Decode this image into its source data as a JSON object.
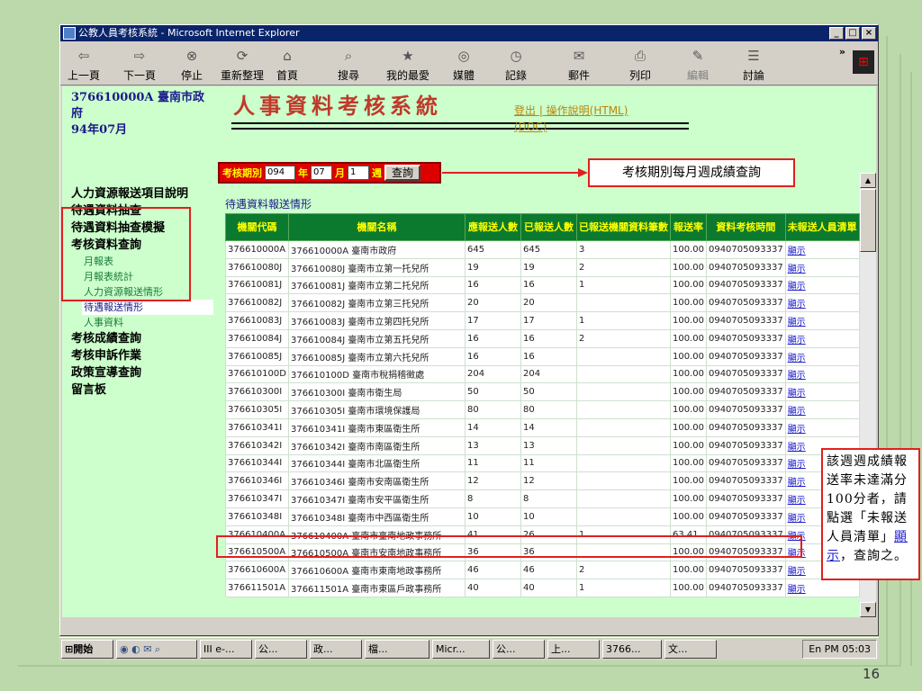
{
  "window": {
    "title": "公教人員考核系統 - Microsoft Internet Explorer",
    "buttons": [
      "_",
      "□",
      "×"
    ]
  },
  "toolbar": {
    "items": [
      {
        "label": "上一頁",
        "icon": "back-arrow-icon",
        "glyph": "⇦"
      },
      {
        "label": "下一頁",
        "icon": "forward-arrow-icon",
        "glyph": "⇨"
      },
      {
        "label": "停止",
        "icon": "stop-icon",
        "glyph": "⊗"
      },
      {
        "label": "重新整理",
        "icon": "refresh-icon",
        "glyph": "⟳"
      },
      {
        "label": "首頁",
        "icon": "home-icon",
        "glyph": "⌂"
      },
      {
        "label": "搜尋",
        "icon": "search-icon",
        "glyph": "⌕"
      },
      {
        "label": "我的最愛",
        "icon": "favorites-icon",
        "glyph": "★"
      },
      {
        "label": "媒體",
        "icon": "media-icon",
        "glyph": "◎"
      },
      {
        "label": "記錄",
        "icon": "history-icon",
        "glyph": "◷"
      },
      {
        "label": "郵件",
        "icon": "mail-icon",
        "glyph": "✉"
      },
      {
        "label": "列印",
        "icon": "print-icon",
        "glyph": "⎙"
      },
      {
        "label": "編輯",
        "icon": "edit-icon",
        "glyph": "✎"
      },
      {
        "label": "討論",
        "icon": "discuss-icon",
        "glyph": "☰"
      }
    ]
  },
  "sidebar": {
    "org_line1": "376610000A 臺南市政府",
    "org_line2": "94年07月",
    "menu": [
      {
        "label": "人力資源報送項目說明",
        "level": 1
      },
      {
        "label": "待遇資料抽查",
        "level": 1
      },
      {
        "label": "待遇資料抽查模擬",
        "level": 1
      },
      {
        "label": "考核資料查詢",
        "level": 1
      },
      {
        "label": "月報表",
        "level": 2
      },
      {
        "label": "月報表統計",
        "level": 2
      },
      {
        "label": "人力資源報送情形",
        "level": 2
      },
      {
        "label": "待遇報送情形",
        "level": 2,
        "selected": true
      },
      {
        "label": "人事資料",
        "level": 2
      },
      {
        "label": "考核成績查詢",
        "level": 1
      },
      {
        "label": "考核申訴作業",
        "level": 1
      },
      {
        "label": "政策宣導查詢",
        "level": 1
      },
      {
        "label": "留言板",
        "level": 1
      }
    ]
  },
  "header": {
    "system_title": "人事資料考核系統",
    "links_line1": "登出 | 操作說明(HTML)",
    "links_line2": "(DOC)"
  },
  "query": {
    "period_label": "考核期別",
    "year": "094",
    "year_unit": "年",
    "month": "07",
    "month_unit": "月",
    "week": "1",
    "week_unit": "週",
    "button": "查詢"
  },
  "callout_top": "考核期別每月週成績查詢",
  "table": {
    "title": "待遇資料報送情形",
    "headers": [
      "機關代碼",
      "機關名稱",
      "應報送人數",
      "已報送人數",
      "已報送機關資料筆數",
      "報送率",
      "資料考核時間",
      "未報送人員清單"
    ],
    "rows": [
      [
        "376610000A",
        "376610000A 臺南市政府",
        "645",
        "645",
        "3",
        "100.00",
        "0940705093337",
        "顯示"
      ],
      [
        "376610080J",
        "376610080J 臺南市立第一托兒所",
        "19",
        "19",
        "2",
        "100.00",
        "0940705093337",
        "顯示"
      ],
      [
        "376610081J",
        "376610081J 臺南市立第二托兒所",
        "16",
        "16",
        "1",
        "100.00",
        "0940705093337",
        "顯示"
      ],
      [
        "376610082J",
        "376610082J 臺南市立第三托兒所",
        "20",
        "20",
        "",
        "100.00",
        "0940705093337",
        "顯示"
      ],
      [
        "376610083J",
        "376610083J 臺南市立第四托兒所",
        "17",
        "17",
        "1",
        "100.00",
        "0940705093337",
        "顯示"
      ],
      [
        "376610084J",
        "376610084J 臺南市立第五托兒所",
        "16",
        "16",
        "2",
        "100.00",
        "0940705093337",
        "顯示"
      ],
      [
        "376610085J",
        "376610085J 臺南市立第六托兒所",
        "16",
        "16",
        "",
        "100.00",
        "0940705093337",
        "顯示"
      ],
      [
        "376610100D",
        "376610100D 臺南市稅捐稽徵處",
        "204",
        "204",
        "",
        "100.00",
        "0940705093337",
        "顯示"
      ],
      [
        "376610300I",
        "376610300I 臺南市衛生局",
        "50",
        "50",
        "",
        "100.00",
        "0940705093337",
        "顯示"
      ],
      [
        "376610305I",
        "376610305I 臺南市環境保護局",
        "80",
        "80",
        "",
        "100.00",
        "0940705093337",
        "顯示"
      ],
      [
        "376610341I",
        "376610341I 臺南市東區衛生所",
        "14",
        "14",
        "",
        "100.00",
        "0940705093337",
        "顯示"
      ],
      [
        "376610342I",
        "376610342I 臺南市南區衛生所",
        "13",
        "13",
        "",
        "100.00",
        "0940705093337",
        "顯示"
      ],
      [
        "376610344I",
        "376610344I 臺南市北區衛生所",
        "11",
        "11",
        "",
        "100.00",
        "0940705093337",
        "顯示"
      ],
      [
        "376610346I",
        "376610346I 臺南市安南區衛生所",
        "12",
        "12",
        "",
        "100.00",
        "0940705093337",
        "顯示"
      ],
      [
        "376610347I",
        "376610347I 臺南市安平區衛生所",
        "8",
        "8",
        "",
        "100.00",
        "0940705093337",
        "顯示"
      ],
      [
        "376610348I",
        "376610348I 臺南市中西區衛生所",
        "10",
        "10",
        "",
        "100.00",
        "0940705093337",
        "顯示"
      ],
      [
        "376610400A",
        "376610400A 臺南市臺南地政事務所",
        "41",
        "26",
        "1",
        "63.41",
        "0940705093337",
        "顯示"
      ],
      [
        "376610500A",
        "376610500A 臺南市安南地政事務所",
        "36",
        "36",
        "",
        "100.00",
        "0940705093337",
        "顯示"
      ],
      [
        "376610600A",
        "376610600A 臺南市東南地政事務所",
        "46",
        "46",
        "2",
        "100.00",
        "0940705093337",
        "顯示"
      ],
      [
        "376611501A",
        "376611501A 臺南市東區戶政事務所",
        "40",
        "40",
        "1",
        "100.00",
        "0940705093337",
        "顯示"
      ]
    ]
  },
  "callout_side": {
    "text_before": "該週週成績報送率未達滿分100分者，請點選「未報送人員清單」",
    "link": "顯示",
    "text_after": "，查詢之。"
  },
  "taskbar": {
    "start": "開始",
    "items": [
      "III e-...",
      "公...",
      "政...",
      "檔...",
      "Micr...",
      "公...",
      "上...",
      "3766...",
      "文..."
    ],
    "tray": "En",
    "clock": "PM 05:03"
  },
  "page_number": "16",
  "colors": {
    "accent_red": "#e02020",
    "header_green": "#0b7a2f",
    "bg_green": "#ccffcc"
  }
}
